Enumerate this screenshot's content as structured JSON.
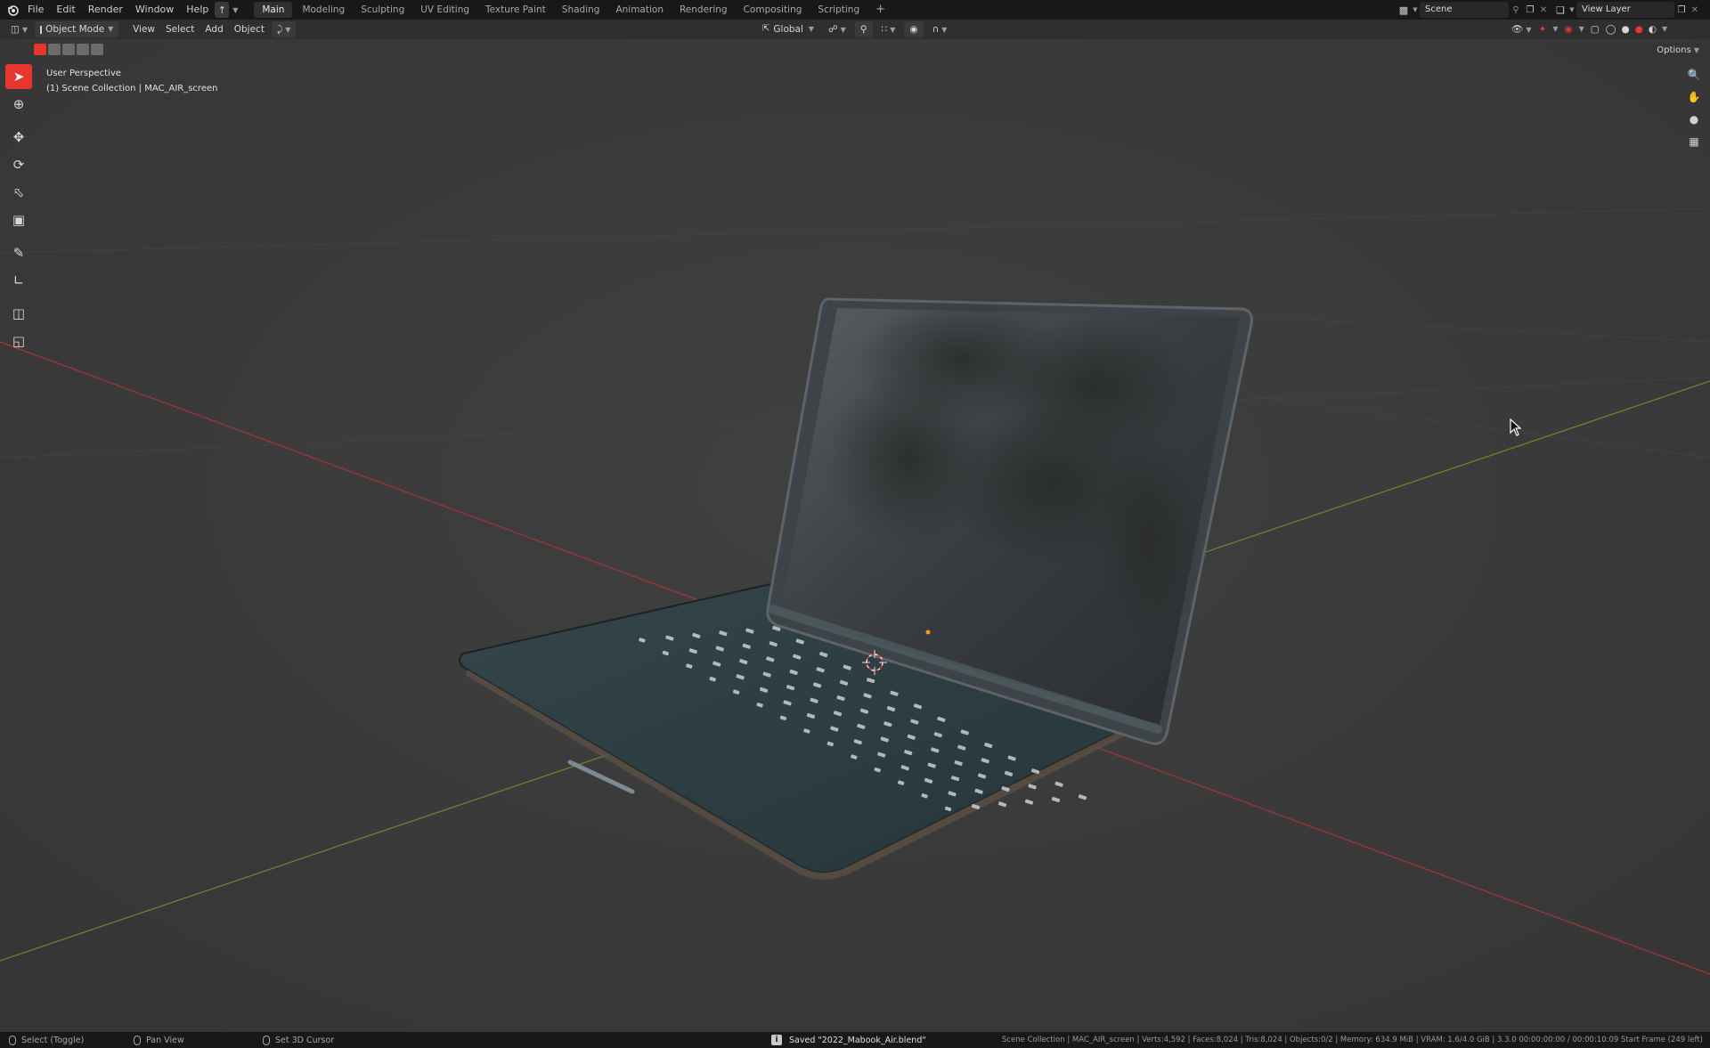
{
  "topbar": {
    "blender_logo": "blender-icon",
    "menus": [
      "File",
      "Edit",
      "Render",
      "Window",
      "Help"
    ],
    "workspaces": [
      "Main",
      "Modeling",
      "Sculpting",
      "UV Editing",
      "Texture Paint",
      "Shading",
      "Animation",
      "Rendering",
      "Compositing",
      "Scripting"
    ],
    "active_workspace": "Main",
    "add_workspace": "+",
    "scene": "Scene",
    "view_layer": "View Layer"
  },
  "header": {
    "mode": "Object Mode",
    "menus": [
      "View",
      "Select",
      "Add",
      "Object"
    ],
    "transform_orientation": "Global",
    "options_label": "Options"
  },
  "viewport": {
    "view_name": "User Perspective",
    "collection_label": "(1) Scene Collection | MAC_AIR_screen"
  },
  "tools": [
    "select-box-icon",
    "cursor-icon",
    "move-icon",
    "rotate-icon",
    "scale-icon",
    "transform-icon",
    "annotate-icon",
    "measure-icon",
    "add-cube-icon",
    "scale-cage-icon"
  ],
  "nav_icons": [
    "zoom-icon",
    "pan-hand-icon",
    "camera-icon",
    "grid-icon"
  ],
  "statusbar": {
    "select": "Select (Toggle)",
    "pan": "Pan View",
    "cursor": "Set 3D Cursor",
    "saved": "Saved \"2022_Mabook_Air.blend\"",
    "stats": "Scene Collection | MAC_AIR_screen | Verts:4,592 | Faces:8,024 | Tris:8,024 | Objects:0/2 | Memory: 634.9 MiB | VRAM: 1.6/4.0 GiB | 3.3.0  00:00:00:00 / 00:00:10:09  Start Frame (249 left)"
  },
  "colors": {
    "accent": "#e8352e",
    "axis_x": "#b03a3a",
    "axis_y": "#6a8f2a",
    "laptop_body": "#2c3b3f"
  }
}
